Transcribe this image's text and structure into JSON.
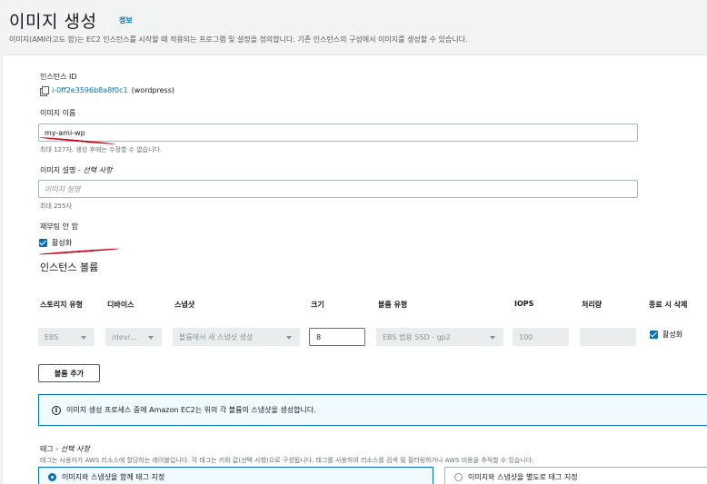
{
  "header": {
    "title": "이미지 생성",
    "info_link": "정보",
    "description": "이미지(AMI라고도 함)는 EC2 인스턴스를 시작할 때 적용되는 프로그램 및 설정을 정의합니다. 기존 인스턴스의 구성에서 이미지를 생성할 수 있습니다."
  },
  "instance": {
    "label": "인스턴스 ID",
    "id": "i-0ff2e3596b8a8f0c1",
    "name": "(wordpress)"
  },
  "image_name": {
    "label": "이미지 이름",
    "value": "my-ami-wp",
    "hint": "최대 127자. 생성 후에는 수정할 수 없습니다."
  },
  "image_description": {
    "label": "이미지 설명 - ",
    "label_optional": "선택 사항",
    "placeholder": "이미지 설명",
    "hint": "최대 255자"
  },
  "no_reboot": {
    "label": "재부팅 안 함",
    "checkbox_label": "활성화",
    "checked": true
  },
  "volumes": {
    "title": "인스턴스 볼륨",
    "columns": [
      "스토리지 유형",
      "디바이스",
      "스냅샷",
      "크기",
      "볼륨 유형",
      "IOPS",
      "처리량",
      "종료 시 삭제"
    ],
    "row": {
      "storage_type": "EBS",
      "device": "/dev/...",
      "snapshot": "볼륨에서 새 스냅샷 생성",
      "size": "8",
      "volume_type": "EBS 범용 SSD - gp2",
      "iops": "100",
      "throughput": "",
      "delete_on_termination": "활성화"
    },
    "add_button": "볼륨 추가"
  },
  "alert": {
    "text": "이미지 생성 프로세스 중에 Amazon EC2는 위의 각 볼륨의 스냅샷을 생성합니다."
  },
  "tags": {
    "label": "태그 - ",
    "label_optional": "선택 사항",
    "description": "태그는 사용자가 AWS 리소스에 할당하는 레이블입니다. 각 태그는 키와 값(선택 사항)으로 구성됩니다. 태그를 사용하여 리소스를 검색 및 필터링하거나 AWS 비용을 추적할 수 있습니다.",
    "option_together": "이미지와 스냅샷을 함께 태그 지정",
    "option_separate": "이미지와 스냅샷을 별도로 태그 지정"
  },
  "colors": {
    "accent": "#0073bb",
    "annotation": "#d0021b"
  }
}
